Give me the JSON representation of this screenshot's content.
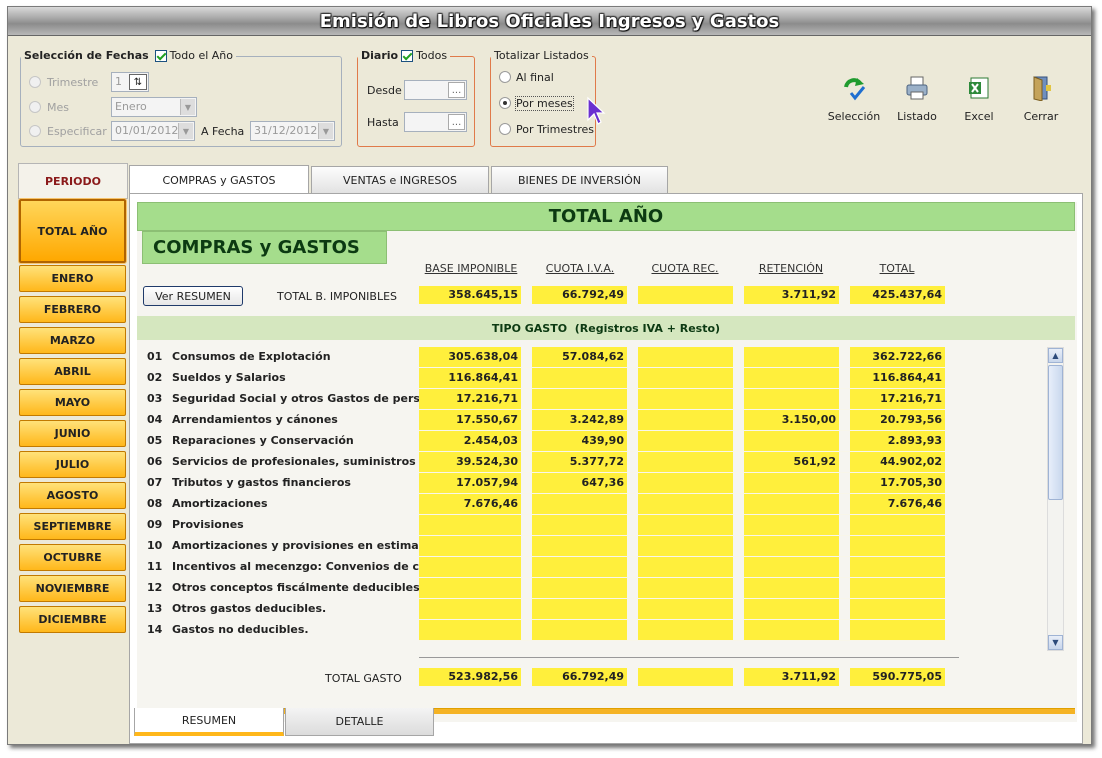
{
  "title": "Emisión de Libros Oficiales Ingresos y Gastos",
  "fechas": {
    "legend": "Selección de Fechas",
    "todo_el_ano": "Todo el Año",
    "trimestre_label": "Trimestre",
    "trimestre_value": "1",
    "mes_label": "Mes",
    "mes_value": "Enero",
    "especificar_label": "Especificar",
    "fecha_desde": "01/01/2012",
    "a_fecha_label": "A Fecha",
    "fecha_hasta": "31/12/2012"
  },
  "diario": {
    "legend": "Diario",
    "todos": "Todos",
    "desde": "Desde",
    "hasta": "Hasta",
    "ellipsis": "..."
  },
  "totalizar": {
    "legend": "Totalizar Listados",
    "options": [
      "Al final",
      "Por meses",
      "Por Trimestres"
    ],
    "selected": "Por meses"
  },
  "toolbar": {
    "seleccion": "Selección",
    "listado": "Listado",
    "excel": "Excel",
    "cerrar": "Cerrar"
  },
  "periodo": {
    "header": "PERIODO",
    "items": [
      "TOTAL AÑO",
      "ENERO",
      "FEBRERO",
      "MARZO",
      "ABRIL",
      "MAYO",
      "JUNIO",
      "JULIO",
      "AGOSTO",
      "SEPTIEMBRE",
      "OCTUBRE",
      "NOVIEMBRE",
      "DICIEMBRE"
    ],
    "selected": "TOTAL AÑO"
  },
  "tabs": [
    "COMPRAS y GASTOS",
    "VENTAS e INGRESOS",
    "BIENES DE INVERSIÓN"
  ],
  "active_tab": "COMPRAS y GASTOS",
  "main": {
    "period_title": "TOTAL AÑO",
    "section_title": "COMPRAS y GASTOS",
    "ver_resumen": "Ver RESUMEN",
    "columns": [
      "BASE IMPONIBLE",
      "CUOTA I.V.A.",
      "CUOTA REC.",
      "RETENCIÓN",
      "TOTAL"
    ],
    "total_bi_label": "TOTAL B. IMPONIBLES",
    "total_bi": [
      "358.645,15",
      "66.792,49",
      "",
      "3.711,92",
      "425.437,64"
    ],
    "tipo_gasto_header": "TIPO GASTO  (Registros IVA + Resto)",
    "rows": [
      {
        "num": "01",
        "label": "Consumos de Explotación",
        "v": [
          "305.638,04",
          "57.084,62",
          "",
          "",
          "362.722,66"
        ]
      },
      {
        "num": "02",
        "label": "Sueldos y Salarios",
        "v": [
          "116.864,41",
          "",
          "",
          "",
          "116.864,41"
        ]
      },
      {
        "num": "03",
        "label": "Seguridad Social y otros Gastos de personal",
        "v": [
          "17.216,71",
          "",
          "",
          "",
          "17.216,71"
        ]
      },
      {
        "num": "04",
        "label": "Arrendamientos y cánones",
        "v": [
          "17.550,67",
          "3.242,89",
          "",
          "3.150,00",
          "20.793,56"
        ]
      },
      {
        "num": "05",
        "label": "Reparaciones y Conservación",
        "v": [
          "2.454,03",
          "439,90",
          "",
          "",
          "2.893,93"
        ]
      },
      {
        "num": "06",
        "label": "Servicios de profesionales, suministros y otros",
        "v": [
          "39.524,30",
          "5.377,72",
          "",
          "561,92",
          "44.902,02"
        ]
      },
      {
        "num": "07",
        "label": "Tributos y gastos financieros",
        "v": [
          "17.057,94",
          "647,36",
          "",
          "",
          "17.705,30"
        ]
      },
      {
        "num": "08",
        "label": "Amortizaciones",
        "v": [
          "7.676,46",
          "",
          "",
          "",
          "7.676,46"
        ]
      },
      {
        "num": "09",
        "label": "Provisiones",
        "v": [
          "",
          "",
          "",
          "",
          ""
        ]
      },
      {
        "num": "10",
        "label": "Amortizaciones y provisiones en estimación",
        "v": [
          "",
          "",
          "",
          "",
          ""
        ]
      },
      {
        "num": "11",
        "label": "Incentivos al mecenzgo: Convenios de colaboración",
        "v": [
          "",
          "",
          "",
          "",
          ""
        ]
      },
      {
        "num": "12",
        "label": "Otros conceptos fiscálmente deducibles: Pérdidas",
        "v": [
          "",
          "",
          "",
          "",
          ""
        ]
      },
      {
        "num": "13",
        "label": "Otros gastos deducibles.",
        "v": [
          "",
          "",
          "",
          "",
          ""
        ]
      },
      {
        "num": "14",
        "label": "Gastos no deducibles.",
        "v": [
          "",
          "",
          "",
          "",
          ""
        ]
      }
    ],
    "total_gasto_label": "TOTAL GASTO",
    "total_gasto": [
      "523.982,56",
      "66.792,49",
      "",
      "3.711,92",
      "590.775,05"
    ]
  },
  "bottom_tabs": [
    "RESUMEN",
    "DETALLE"
  ],
  "active_bottom_tab": "RESUMEN"
}
